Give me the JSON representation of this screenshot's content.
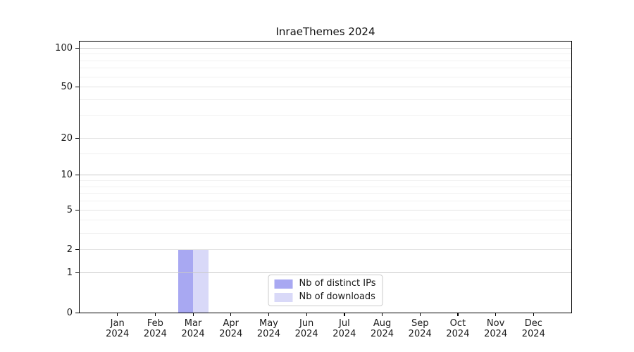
{
  "chart_data": {
    "type": "bar",
    "title": "InraeThemes 2024",
    "categories": [
      "Jan",
      "Feb",
      "Mar",
      "Apr",
      "May",
      "Jun",
      "Jul",
      "Aug",
      "Sep",
      "Oct",
      "Nov",
      "Dec"
    ],
    "category_year_line": "2024",
    "series": [
      {
        "name": "Nb of distinct IPs",
        "color": "#a8a8f2",
        "values": [
          0,
          0,
          2,
          0,
          0,
          0,
          0,
          0,
          0,
          0,
          0,
          0
        ]
      },
      {
        "name": "Nb of downloads",
        "color": "#d9d9f8",
        "values": [
          0,
          0,
          2,
          0,
          0,
          0,
          0,
          0,
          0,
          0,
          0,
          0
        ]
      }
    ],
    "xlabel": "",
    "ylabel": "",
    "yscale": "log1p",
    "ylim": [
      0,
      112
    ],
    "y_ticks": [
      0,
      1,
      2,
      5,
      10,
      20,
      50,
      100
    ],
    "y_tick_labels": [
      "0",
      "1",
      "2",
      "5",
      "10",
      "20",
      "50",
      "100"
    ],
    "y_minor_gridlines": [
      3,
      4,
      6,
      7,
      8,
      9,
      15,
      30,
      40,
      60,
      70,
      80,
      90
    ],
    "grid": "horizontal",
    "legend_position": "lower center"
  }
}
